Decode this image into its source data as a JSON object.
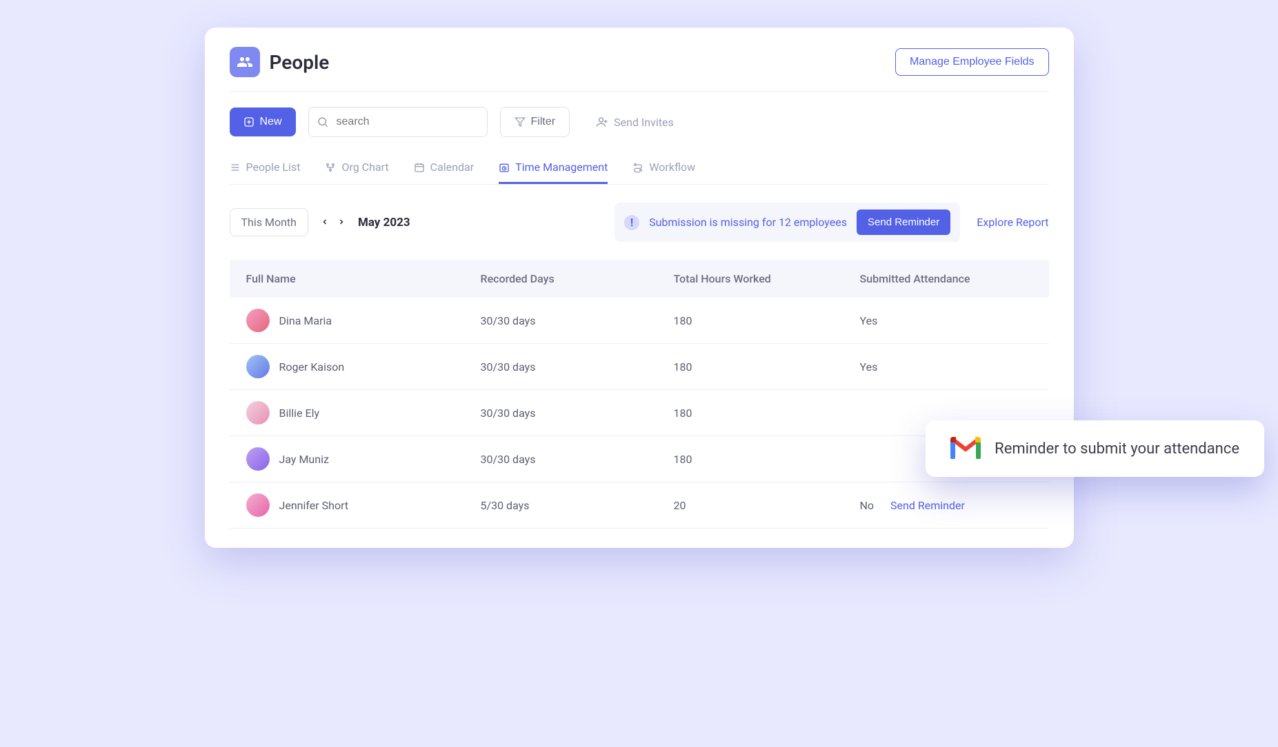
{
  "header": {
    "title": "People",
    "manage_label": "Manage Employee Fields"
  },
  "toolbar": {
    "new_label": "New",
    "search_placeholder": "search",
    "filter_label": "Filter",
    "send_invites_label": "Send Invites"
  },
  "tabs": [
    {
      "label": "People List"
    },
    {
      "label": "Org Chart"
    },
    {
      "label": "Calendar"
    },
    {
      "label": "Time Management"
    },
    {
      "label": "Workflow"
    }
  ],
  "controls": {
    "period_select": "This Month",
    "period_label": "May 2023",
    "alert_text": "Submission is missing for 12 employees",
    "reminder_label": "Send Reminder",
    "explore_label": "Explore Report"
  },
  "table": {
    "headers": {
      "name": "Full Name",
      "days": "Recorded Days",
      "hours": "Total Hours Worked",
      "submitted": "Submitted Attendance"
    },
    "rows": [
      {
        "name": "Dina Maria",
        "days": "30/30 days",
        "hours": "180",
        "submitted": "Yes",
        "action": ""
      },
      {
        "name": "Roger Kaison",
        "days": "30/30 days",
        "hours": "180",
        "submitted": "Yes",
        "action": ""
      },
      {
        "name": "Billie Ely",
        "days": "30/30 days",
        "hours": "180",
        "submitted": "",
        "action": ""
      },
      {
        "name": "Jay Muniz",
        "days": "30/30 days",
        "hours": "180",
        "submitted": "",
        "action": ""
      },
      {
        "name": "Jennifer Short",
        "days": "5/30 days",
        "hours": "20",
        "submitted": "No",
        "action": "Send Reminder"
      }
    ]
  },
  "toast": {
    "text": "Reminder to submit your attendance"
  }
}
